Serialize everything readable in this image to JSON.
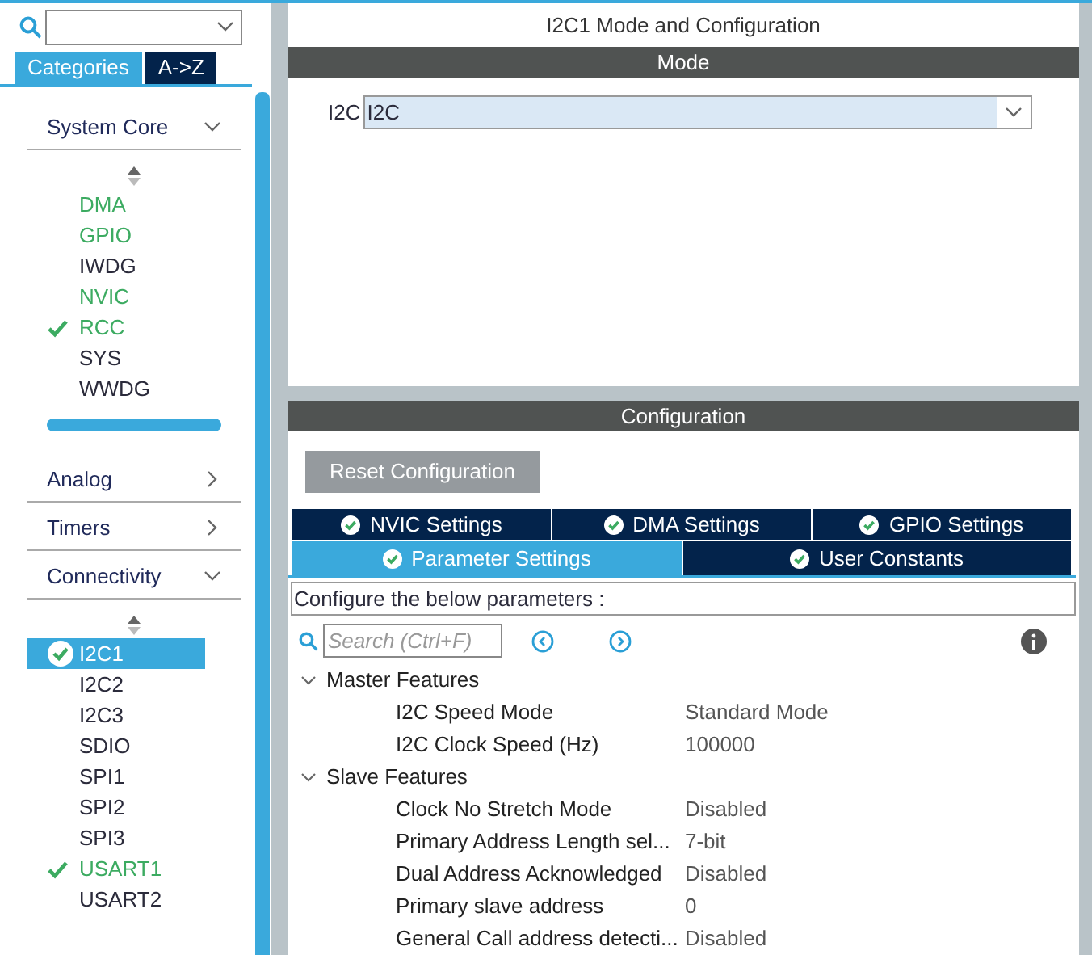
{
  "sidebar": {
    "tabs": [
      {
        "label": "Categories",
        "selected": true
      },
      {
        "label": "A->Z",
        "selected": false
      }
    ],
    "categories": [
      {
        "label": "System Core",
        "expanded": true,
        "items": [
          {
            "label": "DMA",
            "enabled": true,
            "checked": false,
            "selected": false
          },
          {
            "label": "GPIO",
            "enabled": true,
            "checked": false,
            "selected": false
          },
          {
            "label": "IWDG",
            "enabled": false,
            "checked": false,
            "selected": false
          },
          {
            "label": "NVIC",
            "enabled": true,
            "checked": false,
            "selected": false
          },
          {
            "label": "RCC",
            "enabled": true,
            "checked": true,
            "selected": false
          },
          {
            "label": "SYS",
            "enabled": false,
            "checked": false,
            "selected": false
          },
          {
            "label": "WWDG",
            "enabled": false,
            "checked": false,
            "selected": false
          }
        ]
      },
      {
        "label": "Analog",
        "expanded": false
      },
      {
        "label": "Timers",
        "expanded": false
      },
      {
        "label": "Connectivity",
        "expanded": true,
        "items": [
          {
            "label": "I2C1",
            "checked": true,
            "selected": true
          },
          {
            "label": "I2C2",
            "enabled": false,
            "checked": false,
            "selected": false
          },
          {
            "label": "I2C3",
            "enabled": false,
            "checked": false,
            "selected": false
          },
          {
            "label": "SDIO",
            "enabled": false,
            "checked": false,
            "selected": false
          },
          {
            "label": "SPI1",
            "enabled": false,
            "checked": false,
            "selected": false
          },
          {
            "label": "SPI2",
            "enabled": false,
            "checked": false,
            "selected": false
          },
          {
            "label": "SPI3",
            "enabled": false,
            "checked": false,
            "selected": false
          },
          {
            "label": "USART1",
            "enabled": true,
            "checked": true,
            "selected": false
          },
          {
            "label": "USART2",
            "enabled": false,
            "checked": false,
            "selected": false
          }
        ]
      }
    ]
  },
  "main": {
    "title": "I2C1 Mode and Configuration",
    "mode_header": "Mode",
    "mode_field": {
      "label": "I2C",
      "value": "I2C"
    },
    "config_header": "Configuration",
    "reset_button": "Reset Configuration",
    "tabs": [
      [
        {
          "label": "NVIC Settings",
          "selected": false
        },
        {
          "label": "DMA Settings",
          "selected": false
        },
        {
          "label": "GPIO Settings",
          "selected": false
        }
      ],
      [
        {
          "label": "Parameter Settings",
          "selected": true
        },
        {
          "label": "User Constants",
          "selected": false
        }
      ]
    ],
    "hint": "Configure the below parameters :",
    "search": {
      "placeholder": "Search (Ctrl+F)"
    },
    "groups": [
      {
        "label": "Master Features",
        "expanded": true,
        "params": [
          {
            "name": "I2C Speed Mode",
            "value": "Standard Mode"
          },
          {
            "name": "I2C Clock Speed (Hz)",
            "value": "100000"
          }
        ]
      },
      {
        "label": "Slave Features",
        "expanded": true,
        "params": [
          {
            "name": "Clock No Stretch Mode",
            "value": "Disabled"
          },
          {
            "name": "Primary Address Length sel...",
            "value": "7-bit"
          },
          {
            "name": "Dual Address Acknowledged",
            "value": "Disabled"
          },
          {
            "name": "Primary slave address",
            "value": "0"
          },
          {
            "name": "General Call address detecti...",
            "value": "Disabled"
          }
        ]
      }
    ]
  }
}
